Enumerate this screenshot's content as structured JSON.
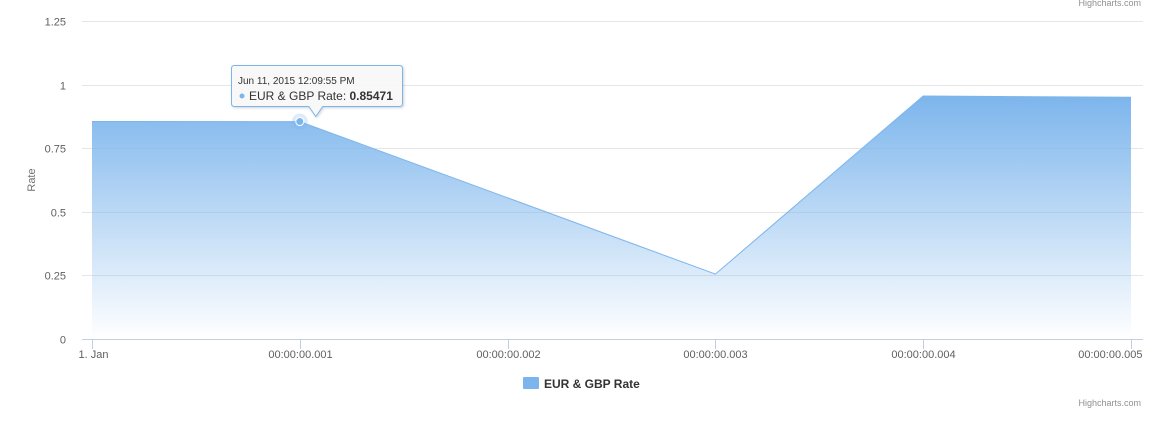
{
  "chart_data": {
    "type": "area",
    "title": "",
    "xlabel": "",
    "ylabel": "Rate",
    "ylim": [
      0,
      1.25
    ],
    "yticks": [
      "0",
      "0.25",
      "0.5",
      "0.75",
      "1",
      "1.25"
    ],
    "x_tick_labels": [
      "1. Jan",
      "00:00:00.001",
      "00:00:00.002",
      "00:00:00.003",
      "00:00:00.004",
      "00:00:00.005"
    ],
    "grid": true,
    "legend_position": "bottom",
    "series": [
      {
        "name": "EUR & GBP Rate",
        "color": "#7cb5ec",
        "values": [
          0.855,
          0.85471,
          0.555,
          0.255,
          0.955,
          0.95
        ]
      }
    ],
    "tooltip": {
      "date": "Jun 11, 2015 12:09:55 PM",
      "series_label": "EUR & GBP Rate: ",
      "value": "0.85471",
      "point_index": 1
    }
  },
  "credits": {
    "top": "Highcharts.com",
    "bottom": "Highcharts.com"
  }
}
